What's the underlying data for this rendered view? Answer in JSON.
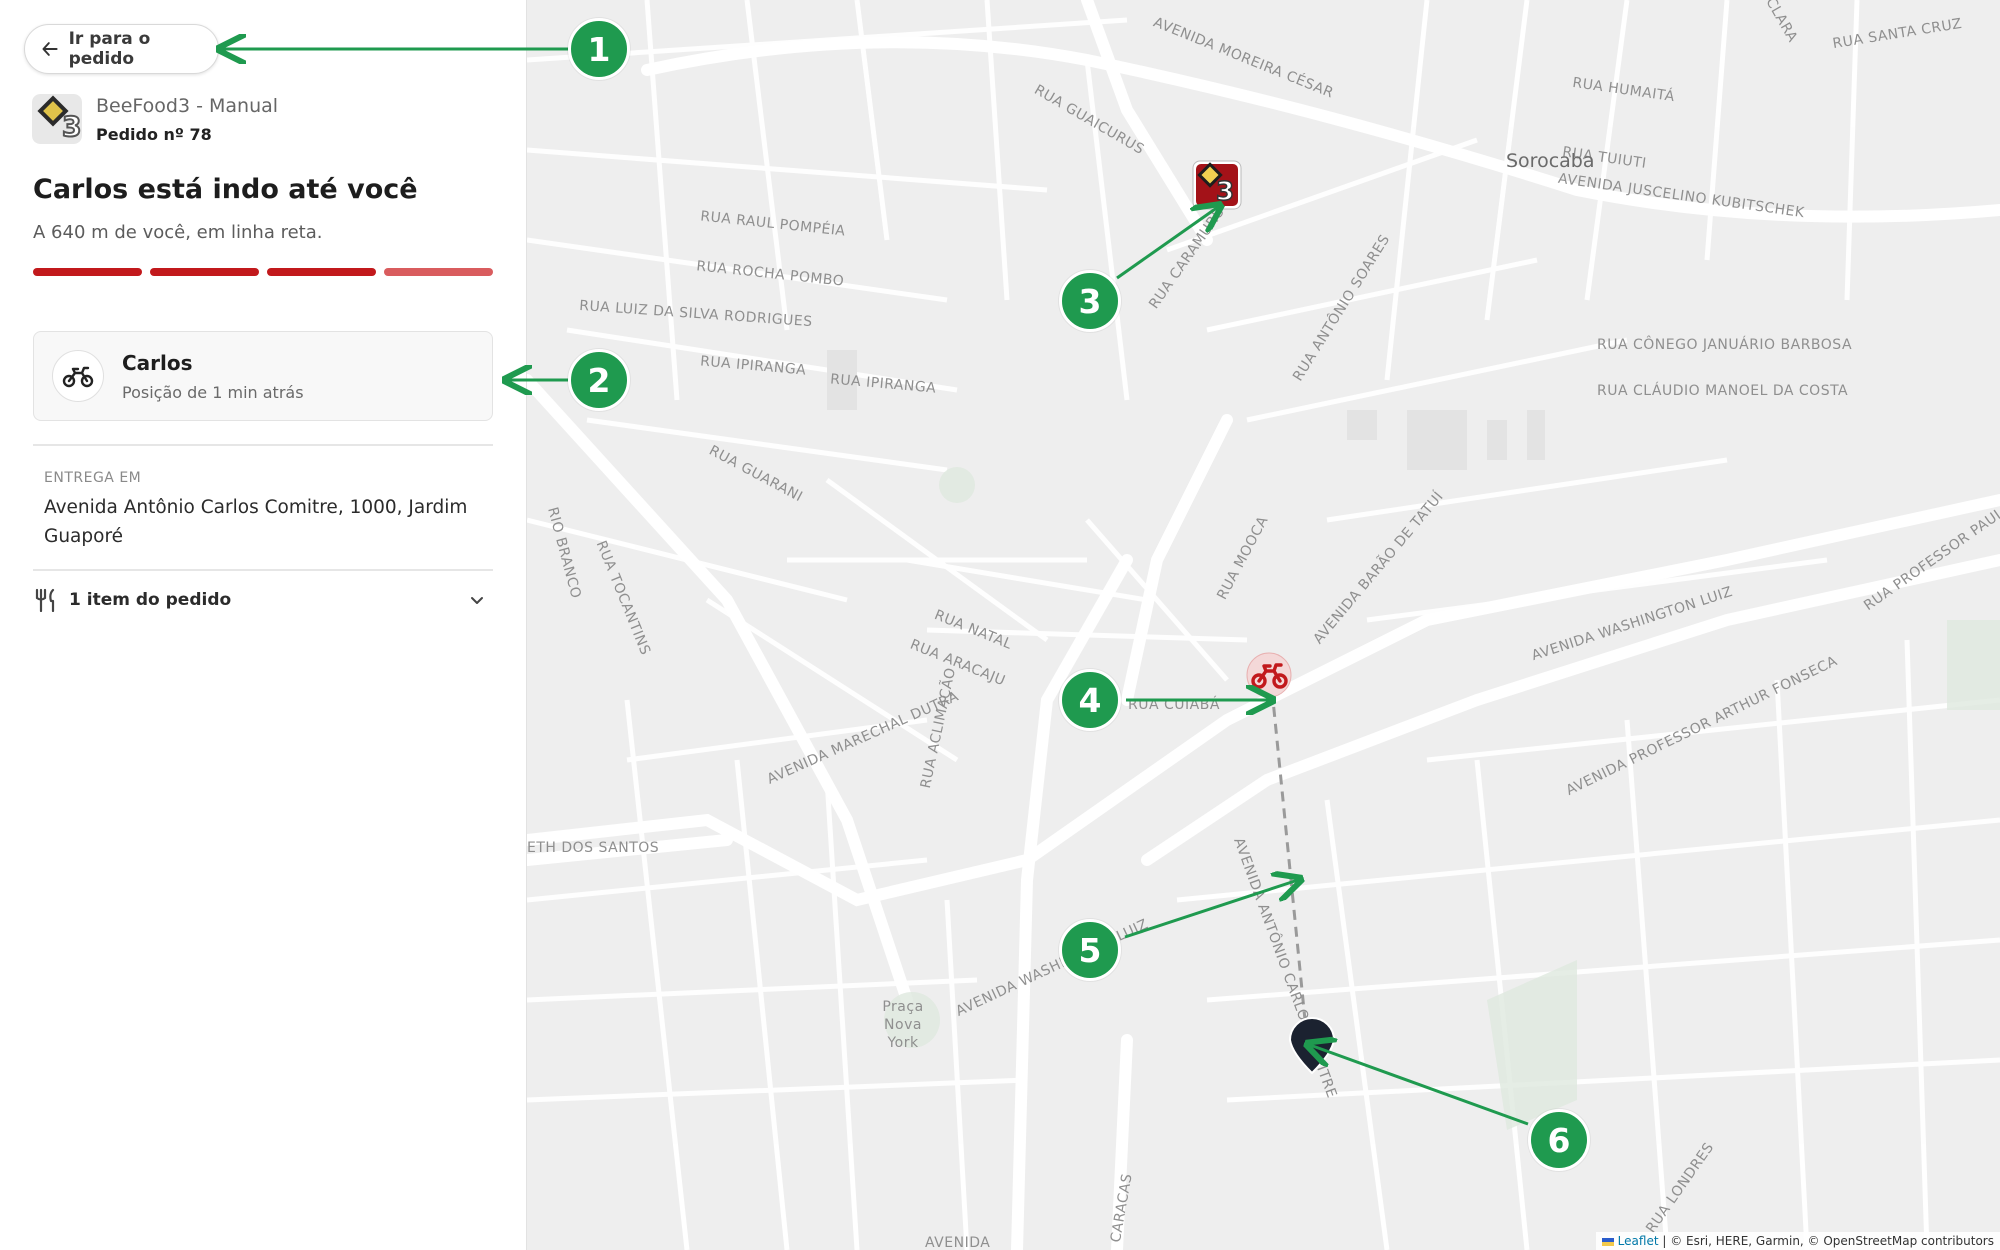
{
  "back_button": {
    "label": "Ir para o pedido"
  },
  "store": {
    "name": "BeeFood3 - Manual",
    "order": "Pedido nº 78",
    "logo_icon": "beefood-logo-icon"
  },
  "status": {
    "headline": "Carlos está indo até você",
    "distance": "A 640 m de você, em linha reta.",
    "progress": {
      "steps_total": 4,
      "steps_completed": 3,
      "partial_step_color": "#d95c5e",
      "step_color": "#c2191c"
    }
  },
  "driver": {
    "name": "Carlos",
    "position_note": "Posição de 1 min atrás",
    "icon": "motorcycle-icon"
  },
  "delivery": {
    "label": "ENTREGA EM",
    "address": "Avenida Antônio Carlos Comitre, 1000, Jardim Guaporé"
  },
  "order_items": {
    "label": "1 item do pedido",
    "icon": "fork-knife-icon",
    "toggle_icon": "chevron-down-icon"
  },
  "map": {
    "city": "Sorocaba",
    "streets": [
      "AVENIDA MOREIRA CÉSAR",
      "RUA SANTA CRUZ",
      "RUA HUMAITÁ",
      "RUA TUIUTI",
      "AVENIDA JUSCELINO KUBITSCHEK",
      "RUA GUAICURUS",
      "RUA RAUL POMPÉIA",
      "RUA ROCHA POMBO",
      "RUA LUIZ DA SILVA RODRIGUES",
      "RUA IPIRANGA",
      "RUA IPIRANGA",
      "RUA CARAMURU",
      "RUA ANTÔNIO SOARES",
      "RUA CÔNEGO JANUÁRIO BARBOSA",
      "RUA CLÁUDIO MANOEL DA COSTA",
      "RUA GUARANI",
      "RUA MOOCA",
      "AVENIDA BARÃO DE TATUÍ",
      "RIO BRANCO",
      "RUA TOCANTINS",
      "RUA NATAL",
      "RUA ARACAJU",
      "RUA CUIABÁ",
      "AVENIDA MARECHAL DUTRA",
      "RUA ACLIMAÇÃO",
      "AVENIDA WASHINGTON LUIZ",
      "AVENIDA PROFESSOR ARTHUR FONSECA",
      "RUA PROFESSOR PAULO MO",
      "ETH DOS SANTOS",
      "AVENIDA WASHINGTON LUIZ",
      "AVENIDA ANTÔNIO CARLOS COMITRE",
      "CARACAS",
      "AVENIDA",
      "RUA LONDRES",
      "CLARA"
    ],
    "park": "Praça Nova York",
    "attribution_link": "Leaflet",
    "attribution_text": "| © Esri, HERE, Garmin, © OpenStreetMap contributors",
    "markers": [
      "store-marker",
      "driver-marker",
      "destination-pin"
    ]
  },
  "callouts": [
    "1",
    "2",
    "3",
    "4",
    "5",
    "6"
  ],
  "colors": {
    "accent": "#c2191c",
    "callout": "#1f9a4f",
    "pin": "#1b2230"
  }
}
